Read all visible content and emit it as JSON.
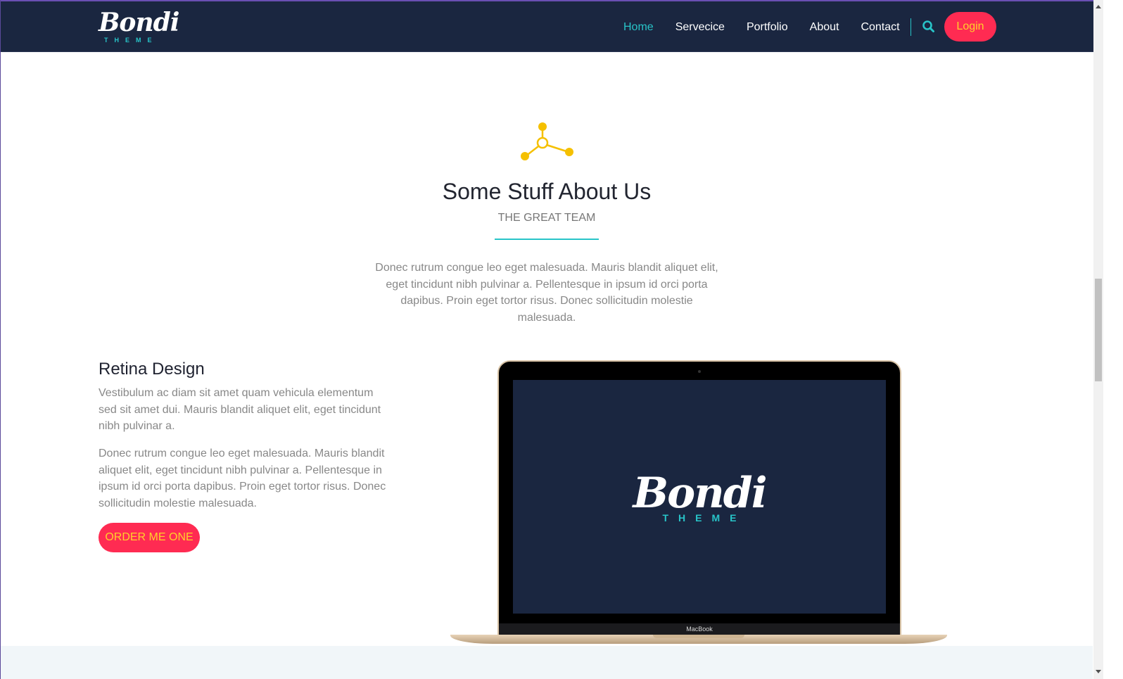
{
  "brand": {
    "logo_word": "Bondi",
    "logo_sub": "THEME"
  },
  "nav": {
    "items": [
      {
        "label": "Home",
        "active": true
      },
      {
        "label": "Servecice",
        "active": false
      },
      {
        "label": "Portfolio",
        "active": false
      },
      {
        "label": "About",
        "active": false
      },
      {
        "label": "Contact",
        "active": false
      }
    ],
    "search_icon": "search-icon",
    "login_label": "Login"
  },
  "about": {
    "icon": "share-network-icon",
    "title": "Some Stuff About Us",
    "subtitle": "THE GREAT TEAM",
    "intro": "Donec rutrum congue leo eget malesuada. Mauris blandit aliquet elit, eget tincidunt nibh pulvinar a. Pellentesque in ipsum id orci porta dapibus. Proin eget tortor risus. Donec sollicitudin molestie malesuada."
  },
  "feature": {
    "title": "Retina Design",
    "paragraph_1": "Vestibulum ac diam sit amet quam vehicula elementum sed sit amet dui. Mauris blandit aliquet elit, eget tincidunt nibh pulvinar a.",
    "paragraph_2": "Donec rutrum congue leo eget malesuada. Mauris blandit aliquet elit, eget tincidunt nibh pulvinar a. Pellentesque in ipsum id orci porta dapibus. Proin eget tortor risus. Donec sollicitudin molestie malesuada.",
    "button_label": "ORDER ME ONE"
  },
  "laptop": {
    "screen_logo_word": "Bondi",
    "screen_logo_sub": "THEME",
    "label": "MacBook"
  },
  "colors": {
    "navbar_bg": "#1a2640",
    "accent_teal": "#28c4c8",
    "button_bg": "#ff2b52",
    "button_text": "#ffd12a",
    "icon_yellow": "#f5c000"
  }
}
